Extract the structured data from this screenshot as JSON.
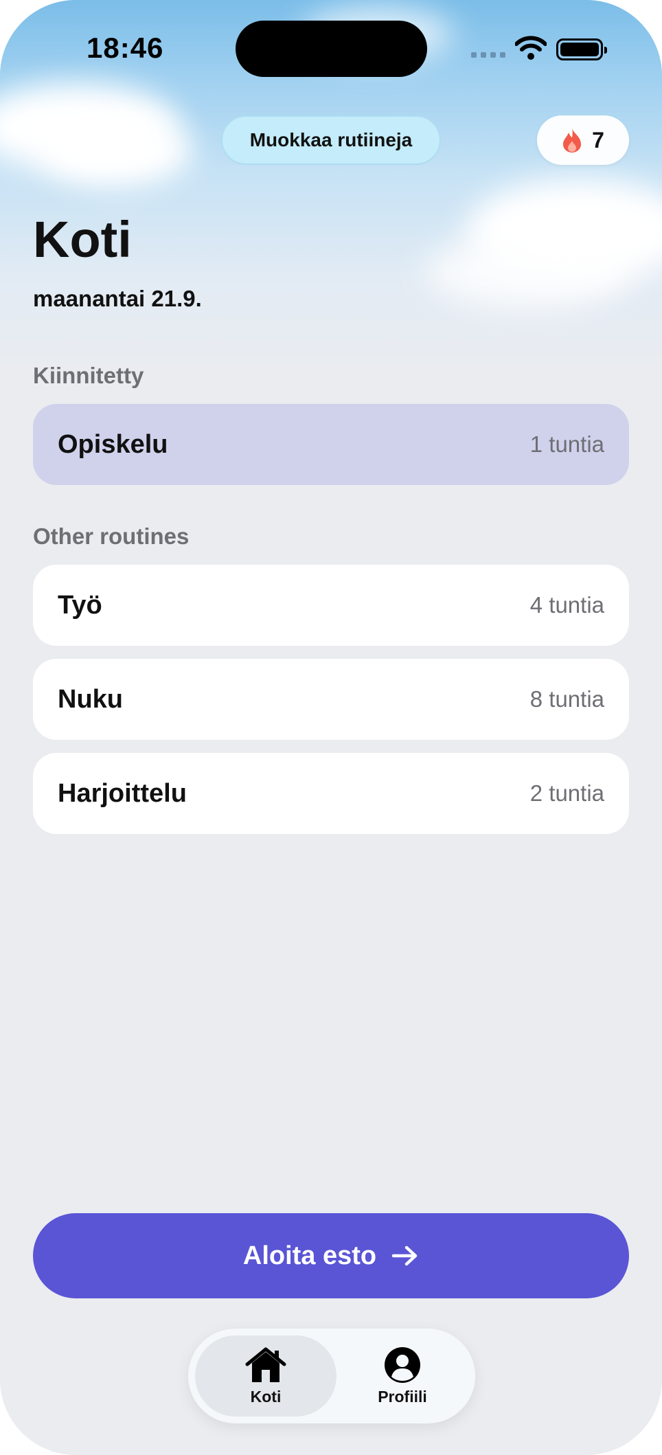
{
  "status_bar": {
    "time": "18:46"
  },
  "header": {
    "edit_routines_label": "Muokkaa rutiineja",
    "streak_count": "7",
    "streak_icon": "flame-icon"
  },
  "page": {
    "title": "Koti",
    "date": "maanantai 21.9."
  },
  "pinned": {
    "label": "Kiinnitetty",
    "item": {
      "name": "Opiskelu",
      "duration": "1 tuntia"
    }
  },
  "other": {
    "label": "Other routines",
    "items": [
      {
        "name": "Työ",
        "duration": "4 tuntia"
      },
      {
        "name": "Nuku",
        "duration": "8 tuntia"
      },
      {
        "name": "Harjoittelu",
        "duration": "2 tuntia"
      }
    ]
  },
  "start_button": {
    "label": "Aloita esto",
    "icon": "arrow-right-icon"
  },
  "tabbar": {
    "tabs": [
      {
        "label": "Koti",
        "icon": "home-icon",
        "active": true
      },
      {
        "label": "Profiili",
        "icon": "profile-icon",
        "active": false
      }
    ]
  },
  "colors": {
    "accent": "#5a55d5",
    "pinned_bg": "#d0d2ec",
    "edit_button_bg": "#c4ecfa",
    "flame": "#f25a4a",
    "background": "#ebecf0"
  }
}
